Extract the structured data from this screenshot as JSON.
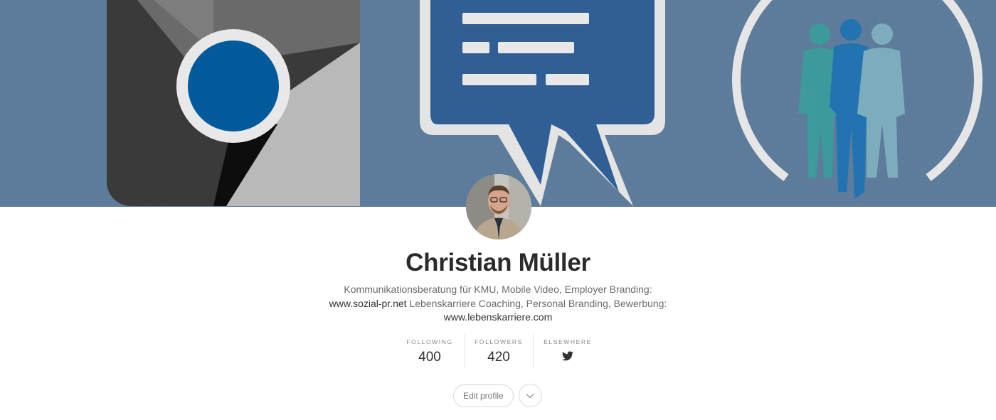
{
  "profile": {
    "name": "Christian Müller",
    "bio_text_1": "Kommunikationsberatung für KMU, Mobile Video, Employer Branding: ",
    "bio_link_1": "www.sozial-pr.net",
    "bio_text_2": " Lebenskarriere Coaching, Personal Branding, Bewerbung: ",
    "bio_link_2": "www.lebenskarriere.com"
  },
  "stats": {
    "following_label": "Following",
    "following_value": "400",
    "followers_label": "Followers",
    "followers_value": "420",
    "elsewhere_label": "Elsewhere",
    "elsewhere_icon": "twitter-icon"
  },
  "actions": {
    "edit_label": "Edit profile",
    "more_icon": "chevron-down-icon"
  },
  "colors": {
    "banner_bg": "#5f7d9c",
    "bubble_blue": "#2f5f95",
    "circle_blue": "#005a9c"
  }
}
